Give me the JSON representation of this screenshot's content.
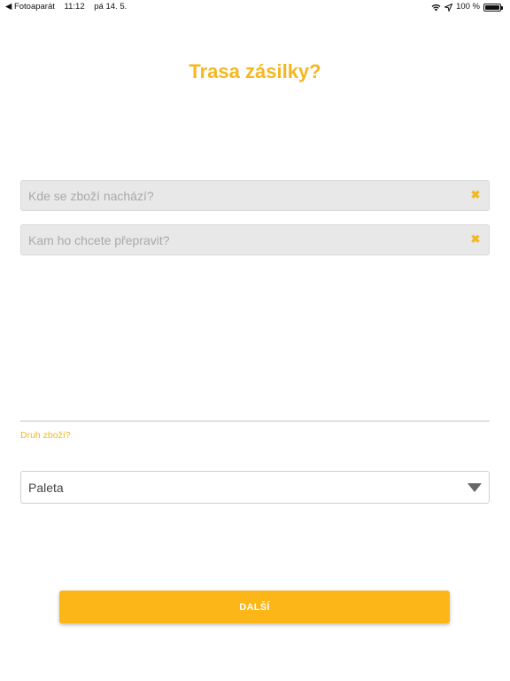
{
  "status_bar": {
    "back_app": "◀ Fotoaparát",
    "time": "11:12",
    "date": "pá 14. 5.",
    "battery": "100 %",
    "battery_level": 1.0
  },
  "page": {
    "title": "Trasa zásilky?"
  },
  "route": {
    "from": {
      "placeholder": "Kde se zboží nachází?",
      "value": ""
    },
    "to": {
      "placeholder": "Kam ho chcete přepravit?",
      "value": ""
    },
    "clear_glyph": "✖"
  },
  "goods": {
    "label": "Druh zboží?",
    "selected": "Paleta"
  },
  "actions": {
    "next_label": "DALŠÍ"
  },
  "colors": {
    "accent": "#f5b71f",
    "button": "#fcb617"
  }
}
